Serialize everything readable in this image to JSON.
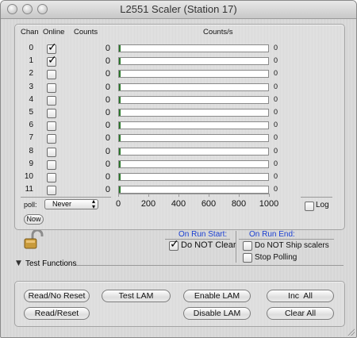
{
  "window": {
    "title": "L2551 Scaler (Station 17)"
  },
  "table": {
    "col_chan": "Chan",
    "col_online": "Online",
    "col_counts": "Counts",
    "col_rate": "Counts/s",
    "rows": [
      {
        "chan": "0",
        "online": true,
        "count": "0",
        "rate": "0",
        "fill": 0.0
      },
      {
        "chan": "1",
        "online": true,
        "count": "0",
        "rate": "0",
        "fill": 0.0
      },
      {
        "chan": "2",
        "online": false,
        "count": "0",
        "rate": "0",
        "fill": 0.0
      },
      {
        "chan": "3",
        "online": false,
        "count": "0",
        "rate": "0",
        "fill": 0.0
      },
      {
        "chan": "4",
        "online": false,
        "count": "0",
        "rate": "0",
        "fill": 0.0
      },
      {
        "chan": "5",
        "online": false,
        "count": "0",
        "rate": "0",
        "fill": 0.0
      },
      {
        "chan": "6",
        "online": false,
        "count": "0",
        "rate": "0",
        "fill": 0.0
      },
      {
        "chan": "7",
        "online": false,
        "count": "0",
        "rate": "0",
        "fill": 0.0
      },
      {
        "chan": "8",
        "online": false,
        "count": "0",
        "rate": "0",
        "fill": 0.0
      },
      {
        "chan": "9",
        "online": false,
        "count": "0",
        "rate": "0",
        "fill": 0.0
      },
      {
        "chan": "10",
        "online": false,
        "count": "0",
        "rate": "0",
        "fill": 0.0
      },
      {
        "chan": "11",
        "online": false,
        "count": "0",
        "rate": "0",
        "fill": 0.0
      }
    ],
    "axis_ticks": [
      "0",
      "200",
      "400",
      "600",
      "800",
      "1000"
    ]
  },
  "poll": {
    "label": "poll:",
    "value": "Never",
    "now_label": "Now"
  },
  "log": {
    "label": "Log",
    "checked": false
  },
  "run_start": {
    "heading": "On Run Start:",
    "do_not_clear_label": "Do NOT Clear",
    "do_not_clear_checked": true
  },
  "run_end": {
    "heading": "On Run End:",
    "ship_label": "Do NOT Ship scalers",
    "ship_checked": false,
    "stop_label": "Stop Polling",
    "stop_checked": false
  },
  "test_functions": {
    "label": "Test Functions"
  },
  "buttons": {
    "read_no_reset": "Read/No Reset",
    "read_reset": "Read/Reset",
    "test_lam": "Test LAM",
    "enable_lam": "Enable LAM",
    "disable_lam": "Disable LAM",
    "inc_all": "Inc  All",
    "clear_all": "Clear All"
  },
  "colors": {
    "accent_blue": "#1a3fd1",
    "bar_fill": "#2d7a2d"
  },
  "icons": {
    "lock": "lock-icon",
    "disclosure": "triangle-down-icon"
  }
}
